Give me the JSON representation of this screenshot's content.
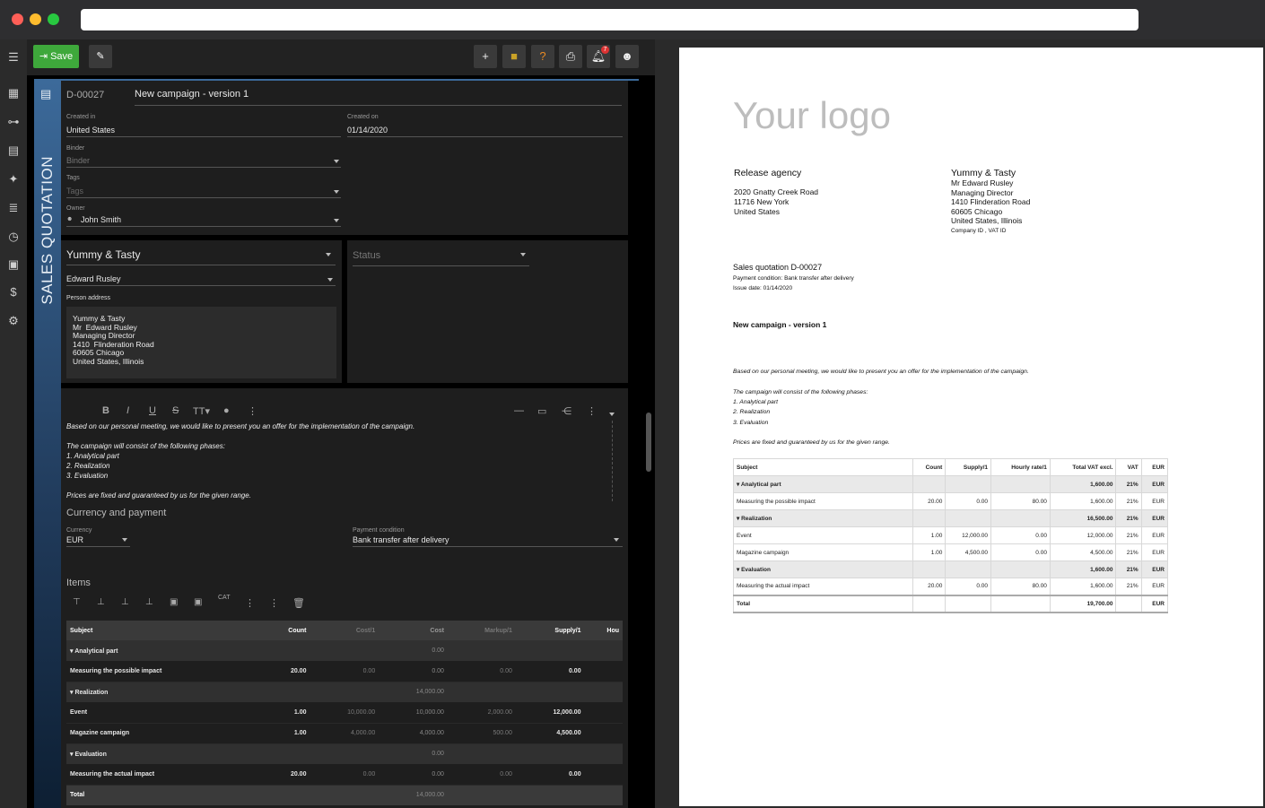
{
  "app": {
    "save_label": "Save",
    "notif_count": "7"
  },
  "doc": {
    "number": "D-00027",
    "title": "New campaign - version 1",
    "side_label": "SALES QUOTATION",
    "created_in_label": "Created in",
    "created_in": "United States",
    "created_on_label": "Created on",
    "created_on": "01/14/2020",
    "binder_label": "Binder",
    "binder_placeholder": "Binder",
    "tags_label": "Tags",
    "tags_placeholder": "Tags",
    "owner_label": "Owner",
    "owner": "John Smith",
    "company": "Yummy & Tasty",
    "person": "Edward Rusley",
    "person_address_label": "Person address",
    "person_address": "Yummy & Tasty\nMr  Edward Rusley\nManaging Director\n1410  Flinderation Road\n60605 Chicago\nUnited States, Illinois",
    "status_placeholder": "Status"
  },
  "editor": {
    "lines": [
      "Based on our personal meeting, we would like to present you an offer for the implementation of the campaign.",
      "",
      "The campaign will consist of the following phases:",
      "1. Analytical part",
      "2. Realization",
      "3. Evaluation",
      "",
      "Prices are fixed and guaranteed by us for the given range."
    ]
  },
  "payment": {
    "section_title": "Currency and payment",
    "currency_label": "Currency",
    "currency": "EUR",
    "condition_label": "Payment condition",
    "condition": "Bank transfer after delivery"
  },
  "items": {
    "section_title": "Items",
    "headers": [
      "Subject",
      "Count",
      "Cost/1",
      "Cost",
      "Markup/1",
      "Supply/1",
      "Hou"
    ],
    "rows": [
      {
        "type": "g",
        "cells": [
          "Analytical part",
          "",
          "",
          "0.00",
          "",
          "",
          ""
        ]
      },
      {
        "type": "r",
        "cells": [
          "Measuring the possible impact",
          "20.00",
          "0.00",
          "0.00",
          "0.00",
          "0.00",
          ""
        ]
      },
      {
        "type": "g",
        "cells": [
          "Realization",
          "",
          "",
          "14,000.00",
          "",
          "",
          ""
        ]
      },
      {
        "type": "r",
        "cells": [
          "Event",
          "1.00",
          "10,000.00",
          "10,000.00",
          "2,000.00",
          "12,000.00",
          ""
        ]
      },
      {
        "type": "r",
        "cells": [
          "Magazine campaign",
          "1.00",
          "4,000.00",
          "4,000.00",
          "500.00",
          "4,500.00",
          ""
        ]
      },
      {
        "type": "g",
        "cells": [
          "Evaluation",
          "",
          "",
          "0.00",
          "",
          "",
          ""
        ]
      },
      {
        "type": "r",
        "cells": [
          "Measuring the actual impact",
          "20.00",
          "0.00",
          "0.00",
          "0.00",
          "0.00",
          ""
        ]
      },
      {
        "type": "t",
        "cells": [
          "Total",
          "",
          "",
          "14,000.00",
          "",
          "",
          ""
        ]
      }
    ]
  },
  "preview": {
    "logo": "Your logo",
    "from_name": "Release agency",
    "from_address": "2020 Gnatty Creek Road\n11716 New York\nUnited States",
    "to_name": "Yummy & Tasty",
    "to_address": "Mr Edward Rusley\nManaging Director\n1410 Flinderation Road\n60605 Chicago\nUnited States, Illinois",
    "to_ids": "Company ID , VAT ID",
    "heading": "Sales quotation D-00027",
    "payment_line": "Payment condition: Bank transfer after delivery",
    "issue_line": "Issue date: 01/14/2020",
    "title": "New campaign - version 1",
    "body": [
      "Based on our personal meeting, we would like to present you an offer for the implementation of the campaign.",
      "",
      "The campaign will consist of the following phases:",
      "1. Analytical part",
      "2. Realization",
      "3. Evaluation",
      "",
      "Prices are fixed and guaranteed by us for the given range."
    ],
    "headers": [
      "Subject",
      "Count",
      "Supply/1",
      "Hourly rate/1",
      "Total VAT excl.",
      "VAT",
      "EUR"
    ],
    "rows": [
      {
        "type": "g",
        "cells": [
          "Analytical part",
          "",
          "",
          "",
          "1,600.00",
          "21%",
          "EUR"
        ]
      },
      {
        "type": "r",
        "cells": [
          "Measuring the possible impact",
          "20.00",
          "0.00",
          "80.00",
          "1,600.00",
          "21%",
          "EUR"
        ]
      },
      {
        "type": "g",
        "cells": [
          "Realization",
          "",
          "",
          "",
          "16,500.00",
          "21%",
          "EUR"
        ]
      },
      {
        "type": "r",
        "cells": [
          "Event",
          "1.00",
          "12,000.00",
          "0.00",
          "12,000.00",
          "21%",
          "EUR"
        ]
      },
      {
        "type": "r",
        "cells": [
          "Magazine campaign",
          "1.00",
          "4,500.00",
          "0.00",
          "4,500.00",
          "21%",
          "EUR"
        ]
      },
      {
        "type": "g",
        "cells": [
          "Evaluation",
          "",
          "",
          "",
          "1,600.00",
          "21%",
          "EUR"
        ]
      },
      {
        "type": "r",
        "cells": [
          "Measuring the actual impact",
          "20.00",
          "0.00",
          "80.00",
          "1,600.00",
          "21%",
          "EUR"
        ]
      },
      {
        "type": "t",
        "cells": [
          "Total",
          "",
          "",
          "",
          "19,700.00",
          "",
          "EUR"
        ]
      }
    ]
  }
}
